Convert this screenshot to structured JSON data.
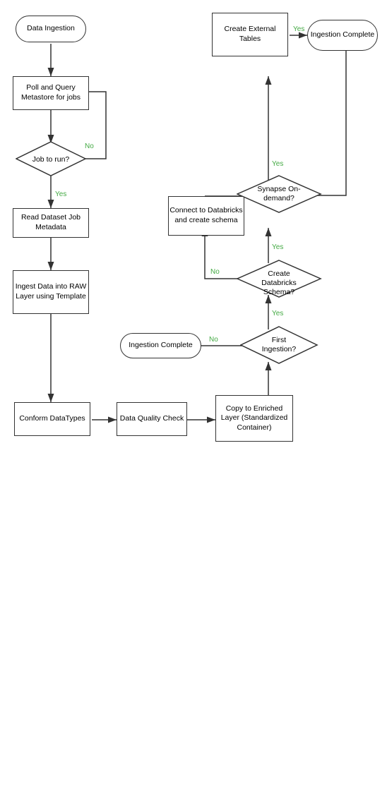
{
  "nodes": {
    "data_ingestion": {
      "label": "Data Ingestion"
    },
    "poll_query": {
      "label": "Poll and Query Metastore for jobs"
    },
    "job_to_run": {
      "label": "Job to run?"
    },
    "read_dataset": {
      "label": "Read Dataset Job Metadata"
    },
    "ingest_data": {
      "label": "Ingest Data into RAW Layer using Template"
    },
    "conform_datatypes": {
      "label": "Conform DataTypes"
    },
    "data_quality": {
      "label": "Data Quality Check"
    },
    "copy_enriched": {
      "label": "Copy to Enriched Layer (Standardized Container)"
    },
    "first_ingestion": {
      "label": "First Ingestion?"
    },
    "ingestion_complete_left": {
      "label": "Ingestion Complete"
    },
    "create_databricks": {
      "label": "Create Databricks Schema?"
    },
    "connect_databricks": {
      "label": "Connect to Databricks and create schema"
    },
    "synapse_ondemand": {
      "label": "Synapse On-demand?"
    },
    "create_external": {
      "label": "Create External Tables"
    },
    "ingestion_complete_right": {
      "label": "Ingestion Complete"
    }
  },
  "labels": {
    "yes": "Yes",
    "no": "No"
  }
}
